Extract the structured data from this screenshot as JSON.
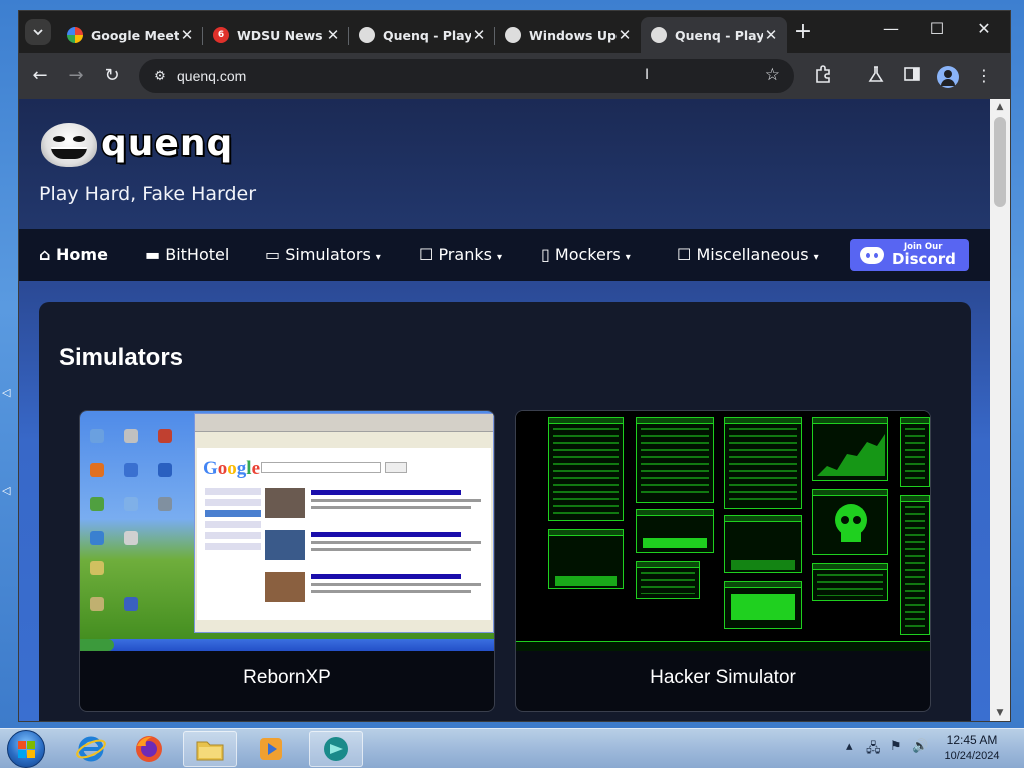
{
  "browser": {
    "tabs": [
      {
        "title": "Google Meet",
        "favicon": "google-meet-favicon",
        "active": false
      },
      {
        "title": "WDSU News",
        "favicon": "wdsu-favicon",
        "active": false
      },
      {
        "title": "Quenq - Play",
        "favicon": "quenq-favicon",
        "active": false
      },
      {
        "title": "Windows Upd",
        "favicon": "quenq-favicon",
        "active": false
      },
      {
        "title": "Quenq - Play",
        "favicon": "quenq-favicon",
        "active": true
      }
    ],
    "url": "quenq.com",
    "accent_color": "#35363a"
  },
  "site": {
    "logo_text": "quenq",
    "tagline": "Play Hard, Fake Harder",
    "nav": [
      {
        "label": "Home",
        "icon": "home-icon"
      },
      {
        "label": "BitHotel",
        "icon": "bed-icon"
      },
      {
        "label": "Simulators",
        "icon": "laptop-icon",
        "caret": "▾"
      },
      {
        "label": "Pranks",
        "icon": "square-icon",
        "caret": "▾"
      },
      {
        "label": "Mockers",
        "icon": "phone-icon",
        "caret": "▾"
      },
      {
        "label": "Miscellaneous",
        "icon": "square-icon",
        "caret": "▾"
      }
    ],
    "discord": {
      "small": "Join Our",
      "big": "Discord",
      "color": "#5865f2"
    },
    "section_title": "Simulators",
    "cards": [
      {
        "title": "RebornXP"
      },
      {
        "title": "Hacker Simulator"
      }
    ]
  },
  "taskbar": {
    "time": "12:45 AM",
    "date": "10/24/2024"
  }
}
